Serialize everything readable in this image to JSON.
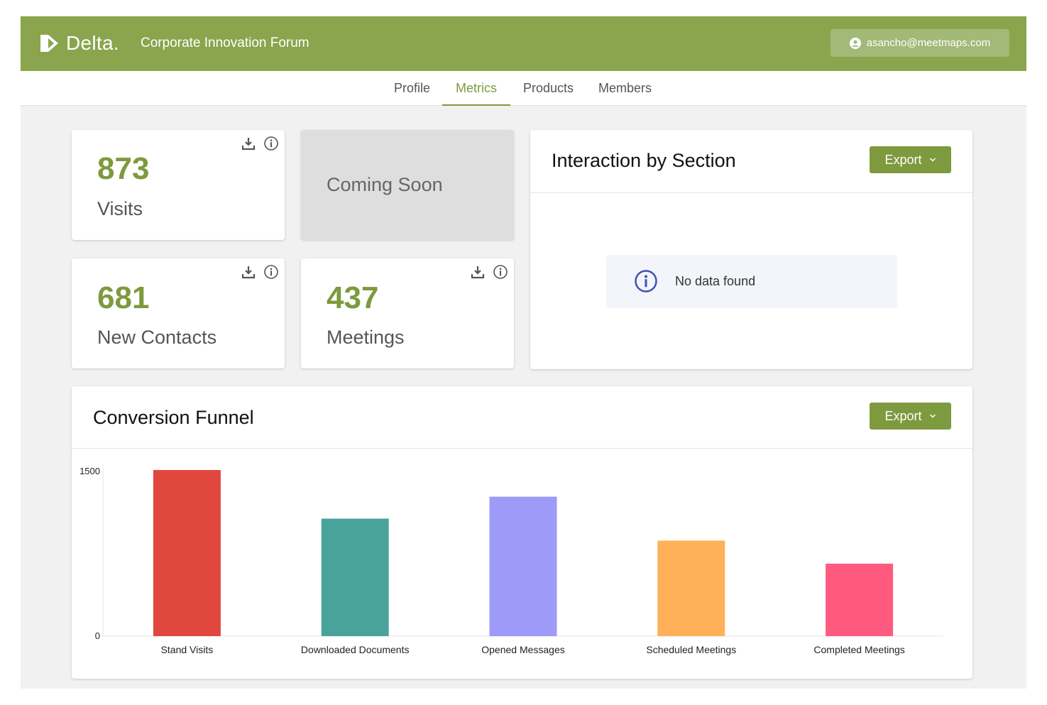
{
  "header": {
    "logo_text": "Delta.",
    "event_title": "Corporate Innovation Forum",
    "user_email": "asancho@meetmaps.com"
  },
  "tabs": [
    {
      "label": "Profile",
      "active": false
    },
    {
      "label": "Metrics",
      "active": true
    },
    {
      "label": "Products",
      "active": false
    },
    {
      "label": "Members",
      "active": false
    }
  ],
  "stats": {
    "visits": {
      "value": "873",
      "label": "Visits"
    },
    "coming_soon": "Coming Soon",
    "new_contacts": {
      "value": "681",
      "label": "New Contacts"
    },
    "meetings": {
      "value": "437",
      "label": "Meetings"
    }
  },
  "interaction": {
    "title": "Interaction by Section",
    "export_label": "Export",
    "no_data": "No data found"
  },
  "funnel": {
    "title": "Conversion Funnel",
    "export_label": "Export"
  },
  "colors": {
    "brand": "#8aa54d",
    "accent": "#7d9a3e",
    "info": "#3f51b5"
  },
  "chart_data": {
    "type": "bar",
    "categories": [
      "Stand Visits",
      "Downloaded Documents",
      "Opened Messages",
      "Scheduled Meetings",
      "Completed Meetings"
    ],
    "values": [
      1515,
      1070,
      1270,
      870,
      660
    ],
    "colors": [
      "#e0483e",
      "#4aa39a",
      "#9e9bf8",
      "#ffb15a",
      "#fe5a7f"
    ],
    "ylim": [
      0,
      1500
    ],
    "yticks": [
      0,
      1500
    ],
    "grid": false,
    "legend": "none"
  }
}
